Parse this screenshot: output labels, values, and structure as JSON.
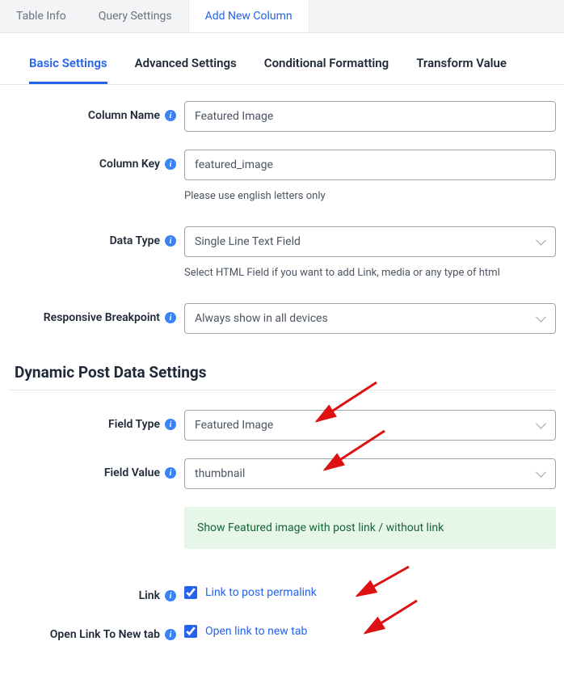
{
  "topbar": {
    "tabs": [
      {
        "label": "Table Info"
      },
      {
        "label": "Query Settings"
      },
      {
        "label": "Add New Column"
      }
    ],
    "active": 2
  },
  "subtabs": {
    "items": [
      {
        "label": "Basic Settings"
      },
      {
        "label": "Advanced Settings"
      },
      {
        "label": "Conditional Formatting"
      },
      {
        "label": "Transform Value"
      }
    ],
    "active": 0
  },
  "basic": {
    "column_name": {
      "label": "Column Name",
      "value": "Featured Image"
    },
    "column_key": {
      "label": "Column Key",
      "value": "featured_image",
      "hint": "Please use english letters only"
    },
    "data_type": {
      "label": "Data Type",
      "value": "Single Line Text Field",
      "hint": "Select HTML Field if you want to add Link, media or any type of html"
    },
    "breakpoint": {
      "label": "Responsive Breakpoint",
      "value": "Always show in all devices"
    }
  },
  "dynamic": {
    "title": "Dynamic Post Data Settings",
    "field_type": {
      "label": "Field Type",
      "value": "Featured Image"
    },
    "field_value": {
      "label": "Field Value",
      "value": "thumbnail"
    },
    "banner": "Show Featured image with post link / without link",
    "link": {
      "label": "Link",
      "checkbox_label": "Link to post permalink",
      "checked": true
    },
    "new_tab": {
      "label": "Open Link To New tab",
      "checkbox_label": "Open link to new tab",
      "checked": true
    }
  }
}
